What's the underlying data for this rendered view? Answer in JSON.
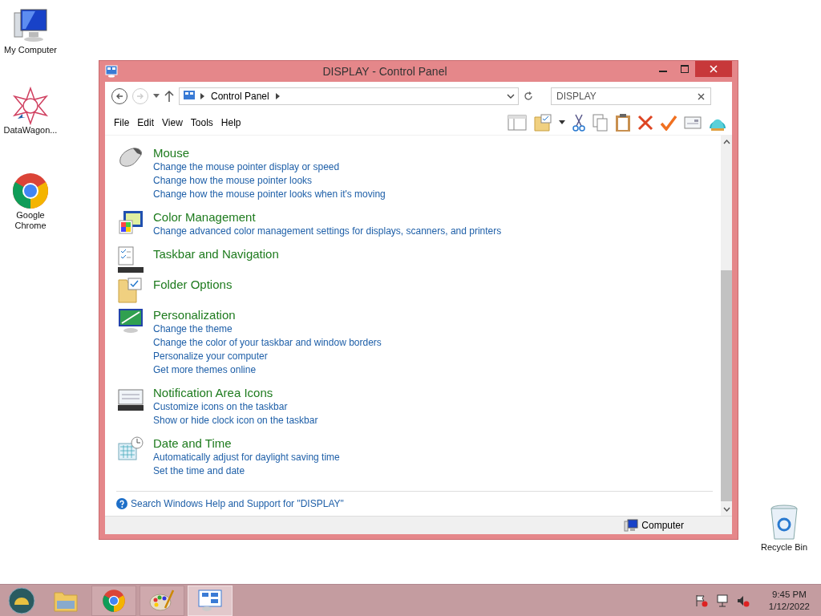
{
  "desktop": {
    "icons": [
      {
        "label": "My Computer"
      },
      {
        "label": "DataWagon..."
      },
      {
        "label": "Google Chrome"
      },
      {
        "label": "Recycle Bin"
      }
    ]
  },
  "window": {
    "title": "DISPLAY - Control Panel",
    "address": {
      "path": "Control Panel"
    },
    "search": {
      "value": "DISPLAY"
    },
    "menu": [
      "File",
      "Edit",
      "View",
      "Tools",
      "Help"
    ],
    "categories": [
      {
        "title": "Mouse",
        "links": [
          "Change the mouse pointer display or speed",
          "Change how the mouse pointer looks",
          "Change how the mouse pointer looks when it's moving"
        ]
      },
      {
        "title": "Color Management",
        "links": [
          "Change advanced color management settings for displays, scanners, and printers"
        ]
      },
      {
        "title": "Taskbar and Navigation"
      },
      {
        "title": "Folder Options"
      },
      {
        "title": "Personalization",
        "links": [
          "Change the theme",
          "Change the color of your taskbar and window borders",
          "Personalize your computer",
          "Get more themes online"
        ]
      },
      {
        "title": "Notification Area Icons",
        "links": [
          "Customize icons on the taskbar",
          "Show or hide clock icon on the taskbar"
        ]
      },
      {
        "title": "Date and Time",
        "links": [
          "Automatically adjust for daylight saving time",
          "Set the time and date"
        ]
      }
    ],
    "help_link": "Search Windows Help and Support for \"DISPLAY\"",
    "status_bar": "Computer"
  },
  "taskbar": {
    "apps": [
      {
        "selected": false
      },
      {
        "selected": false
      },
      {
        "selected": false
      },
      {
        "selected": true
      }
    ],
    "time": "9:45 PM",
    "date": "1/12/2022"
  }
}
